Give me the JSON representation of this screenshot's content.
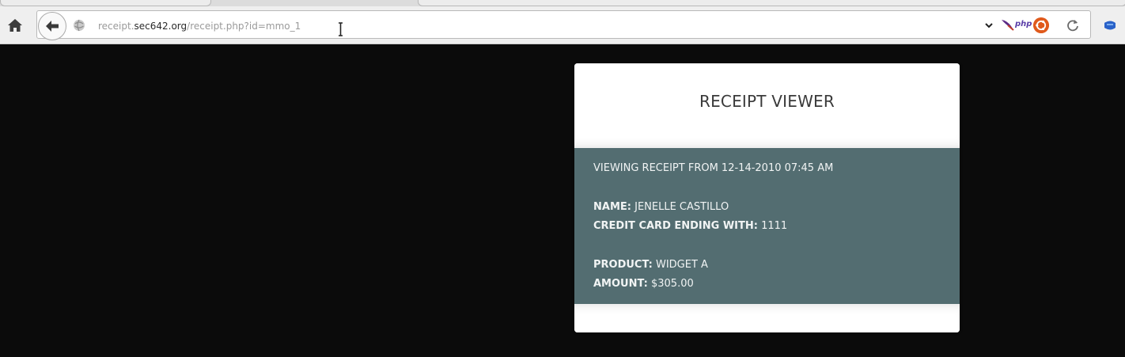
{
  "browser": {
    "url_prefix": "receipt.",
    "url_domain": "sec642.org",
    "url_path": "/receipt.php?id=mmo_1",
    "addon_php_label": "php"
  },
  "receipt": {
    "title": "RECEIPT VIEWER",
    "viewing_text": "VIEWING RECEIPT FROM 12-14-2010 07:45 AM",
    "name_label": "NAME:",
    "name_value": "JENELLE CASTILLO",
    "card_label": "CREDIT CARD ENDING WITH:",
    "card_value": "1111",
    "product_label": "PRODUCT:",
    "product_value": "WIDGET A",
    "amount_label": "AMOUNT:",
    "amount_value": "$305.00"
  },
  "colors": {
    "page_background": "#0b0b0b",
    "card_body": "#536d71",
    "card_text": "#f1f4f4"
  },
  "icons": [
    "home-icon",
    "back-arrow-icon",
    "site-identity-icon",
    "text-cursor-icon",
    "dropdown-icon",
    "feather-icon",
    "ubuntu-icon",
    "reload-icon",
    "extension-icon"
  ]
}
